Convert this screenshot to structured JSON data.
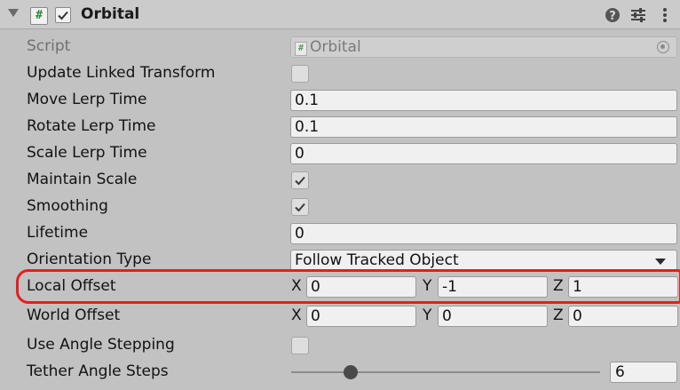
{
  "component": {
    "title": "Orbital",
    "enabled": true
  },
  "icons": {
    "foldout": "foldout-arrow-icon",
    "script": "script-hash-icon",
    "help": "help-icon",
    "presets": "presets-sliders-icon",
    "menu": "kebab-menu-icon",
    "object_picker": "object-picker-icon",
    "dropdown": "dropdown-arrow-icon"
  },
  "header_icon_glyphs": {
    "script": "#",
    "help": "?",
    "menu": "⋮"
  },
  "fields": {
    "script": {
      "label": "Script",
      "value": "Orbital"
    },
    "update_linked_transform": {
      "label": "Update Linked Transform",
      "checked": false
    },
    "move_lerp_time": {
      "label": "Move Lerp Time",
      "value": "0.1"
    },
    "rotate_lerp_time": {
      "label": "Rotate Lerp Time",
      "value": "0.1"
    },
    "scale_lerp_time": {
      "label": "Scale Lerp Time",
      "value": "0"
    },
    "maintain_scale": {
      "label": "Maintain Scale",
      "checked": true
    },
    "smoothing": {
      "label": "Smoothing",
      "checked": true
    },
    "lifetime": {
      "label": "Lifetime",
      "value": "0"
    },
    "orientation_type": {
      "label": "Orientation Type",
      "value": "Follow Tracked Object"
    },
    "local_offset": {
      "label": "Local Offset",
      "x_label": "X",
      "x": "0",
      "y_label": "Y",
      "y": "-1",
      "z_label": "Z",
      "z": "1"
    },
    "world_offset": {
      "label": "World Offset",
      "x_label": "X",
      "x": "0",
      "y_label": "Y",
      "y": "0",
      "z_label": "Z",
      "z": "0"
    },
    "use_angle_stepping": {
      "label": "Use Angle Stepping",
      "checked": false
    },
    "tether_angle_steps": {
      "label": "Tether Angle Steps",
      "value": "6",
      "slider_fraction": 0.19
    }
  },
  "colors": {
    "highlight": "#e81d1d",
    "panel": "#c2c2c2",
    "field": "#f0f0f0"
  }
}
